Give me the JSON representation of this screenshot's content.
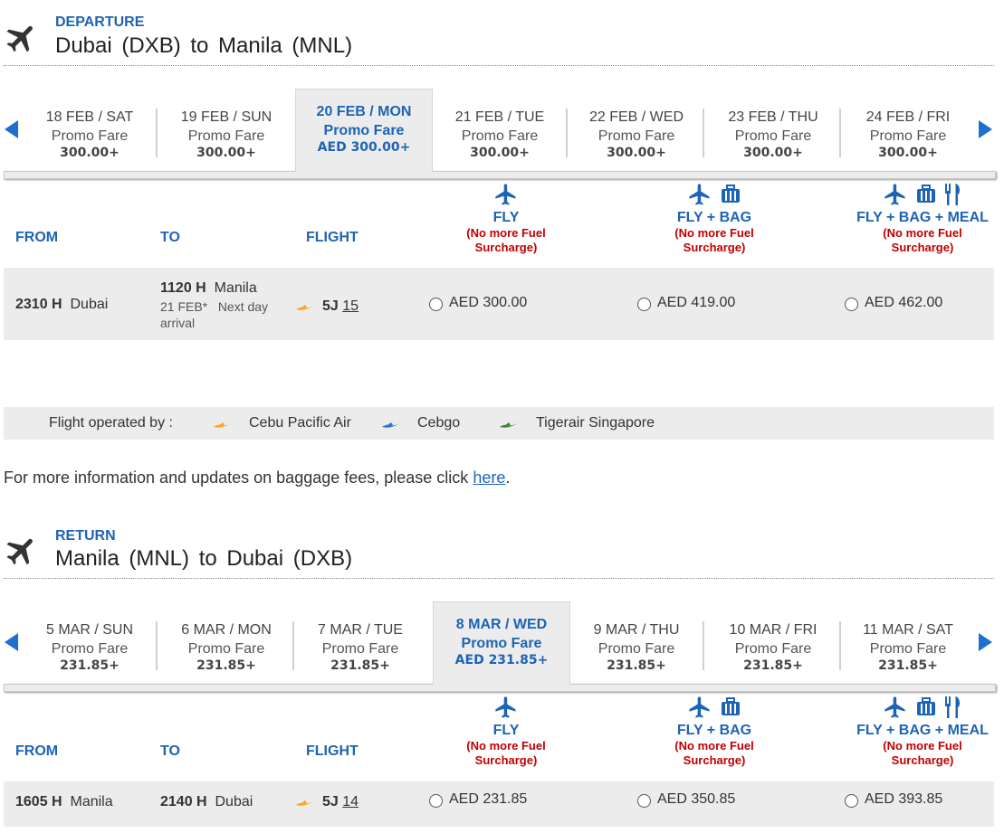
{
  "departure": {
    "tag": "DEPARTURE",
    "title": "Dubai  (DXB)  to  Manila  (MNL)",
    "dates": [
      {
        "date": "18 FEB / SAT",
        "promo": "Promo Fare",
        "amount": "300.00+"
      },
      {
        "date": "19 FEB / SUN",
        "promo": "Promo Fare",
        "amount": "300.00+"
      },
      {
        "date": "20 FEB / MON",
        "promo": "Promo Fare",
        "amount": "AED 300.00+"
      },
      {
        "date": "21 FEB / TUE",
        "promo": "Promo Fare",
        "amount": "300.00+"
      },
      {
        "date": "22 FEB / WED",
        "promo": "Promo Fare",
        "amount": "300.00+"
      },
      {
        "date": "23 FEB / THU",
        "promo": "Promo Fare",
        "amount": "300.00+"
      },
      {
        "date": "24 FEB / FRI",
        "promo": "Promo Fare",
        "amount": "300.00+"
      }
    ],
    "flight": {
      "dep_time": "2310 H",
      "dep_city": "Dubai",
      "arr_time": "1120 H",
      "arr_city": "Manila",
      "arr_date": "21 FEB*",
      "arr_note": "Next day",
      "arr_note2": "arrival",
      "carrier": "5J",
      "number": "15",
      "fares": [
        "AED 300.00",
        "AED 419.00",
        "AED 462.00"
      ]
    }
  },
  "return": {
    "tag": "RETURN",
    "title": "Manila  (MNL) to  Dubai  (DXB)",
    "dates": [
      {
        "date": "5 MAR / SUN",
        "promo": "Promo Fare",
        "amount": "231.85+"
      },
      {
        "date": "6 MAR / MON",
        "promo": "Promo Fare",
        "amount": "231.85+"
      },
      {
        "date": "7 MAR / TUE",
        "promo": "Promo Fare",
        "amount": "231.85+"
      },
      {
        "date": "8 MAR / WED",
        "promo": "Promo Fare",
        "amount": "AED 231.85+"
      },
      {
        "date": "9 MAR / THU",
        "promo": "Promo Fare",
        "amount": "231.85+"
      },
      {
        "date": "10 MAR / FRI",
        "promo": "Promo Fare",
        "amount": "231.85+"
      },
      {
        "date": "11 MAR / SAT",
        "promo": "Promo Fare",
        "amount": "231.85+"
      }
    ],
    "flight": {
      "dep_time": "1605 H",
      "dep_city": "Manila",
      "arr_time": "2140 H",
      "arr_city": "Dubai",
      "carrier": "5J",
      "number": "14",
      "fares": [
        "AED 231.85",
        "AED 350.85",
        "AED 393.85"
      ]
    }
  },
  "columns": {
    "from": "FROM",
    "to": "TO",
    "flight": "FLIGHT"
  },
  "fare_types": [
    {
      "label": "FLY",
      "note1": "(No more Fuel",
      "note2": "Surcharge)"
    },
    {
      "label": "FLY + BAG",
      "note1": "(No more Fuel",
      "note2": "Surcharge)"
    },
    {
      "label": "FLY + BAG + MEAL",
      "note1": "(No more Fuel",
      "note2": "Surcharge)"
    }
  ],
  "operators": {
    "label": "Flight operated by :",
    "items": [
      {
        "name": "Cebu Pacific Air",
        "color": "#f5a623"
      },
      {
        "name": "Cebgo",
        "color": "#2a6fd6"
      },
      {
        "name": "Tigerair Singapore",
        "color": "#3a8a2a"
      }
    ]
  },
  "info": {
    "text": "For more information and updates on baggage fees, please click ",
    "link": "here",
    "end": "."
  },
  "colors": {
    "accent": "#1e64b4",
    "alert": "#c00000",
    "row_bg": "#ececec",
    "cebu": "#f5a623"
  }
}
